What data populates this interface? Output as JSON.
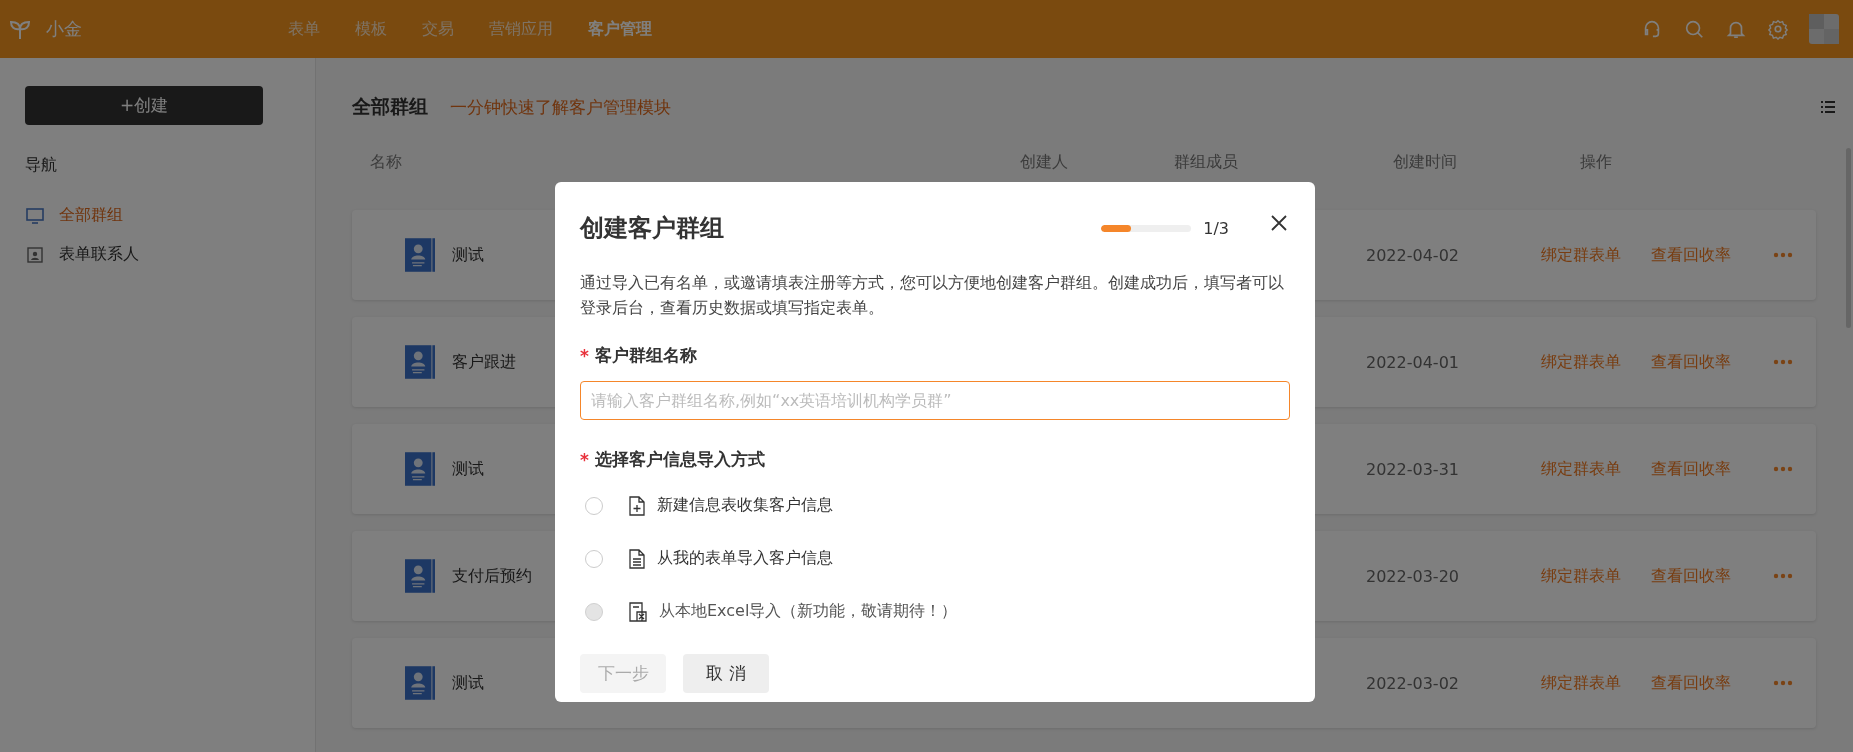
{
  "topbar": {
    "brand": "小金",
    "nav": [
      {
        "label": "表单",
        "selected": false
      },
      {
        "label": "模板",
        "selected": false
      },
      {
        "label": "交易",
        "selected": false
      },
      {
        "label": "营销应用",
        "selected": false
      },
      {
        "label": "客户管理",
        "selected": true
      }
    ]
  },
  "sidebar": {
    "create_button": "+创建",
    "nav_heading": "导航",
    "items": [
      {
        "label": "全部群组",
        "kind": "monitor",
        "selected": true
      },
      {
        "label": "表单联系人",
        "kind": "contact",
        "selected": false
      }
    ]
  },
  "main": {
    "title": "全部群组",
    "help_link": "一分钟快速了解客户管理模块",
    "columns": [
      "名称",
      "创建人",
      "群组成员",
      "创建时间",
      "操作"
    ],
    "rows": [
      {
        "name": "测试",
        "created": "2022-04-02",
        "actions": [
          "绑定群表单",
          "查看回收率"
        ]
      },
      {
        "name": "客户跟进",
        "created": "2022-04-01",
        "actions": [
          "绑定群表单",
          "查看回收率"
        ]
      },
      {
        "name": "测试",
        "created": "2022-03-31",
        "actions": [
          "绑定群表单",
          "查看回收率"
        ]
      },
      {
        "name": "支付后预约",
        "created": "2022-03-20",
        "actions": [
          "绑定群表单",
          "查看回收率"
        ]
      },
      {
        "name": "测试",
        "created": "2022-03-02",
        "actions": [
          "绑定群表单",
          "查看回收率"
        ]
      }
    ]
  },
  "modal": {
    "title": "创建客户群组",
    "progress": {
      "level": 0.33,
      "reading": "1/3"
    },
    "description": "通过导入已有名单，或邀请填表注册等方式，您可以方便地创建客户群组。创建成功后，填写者可以登录后台，查看历史数据或填写指定表单。",
    "name_field": {
      "required_mark": "*",
      "label": "客户群组名称",
      "placeholder": "请输入客户群组名称,例如“xx英语培训机构学员群”"
    },
    "method_field": {
      "required_mark": "*",
      "label": "选择客户信息导入方式",
      "options": [
        {
          "label": "新建信息表收集客户信息",
          "kind": "new",
          "selected": false,
          "disabled": false
        },
        {
          "label": "从我的表单导入客户信息",
          "kind": "form",
          "selected": false,
          "disabled": false
        },
        {
          "label": "从本地Excel导入（新功能，敬请期待！）",
          "kind": "excel",
          "selected": false,
          "disabled": true
        }
      ]
    },
    "buttons": [
      {
        "label": "下一步",
        "disabled": true
      },
      {
        "label": "取 消",
        "disabled": false
      }
    ]
  }
}
